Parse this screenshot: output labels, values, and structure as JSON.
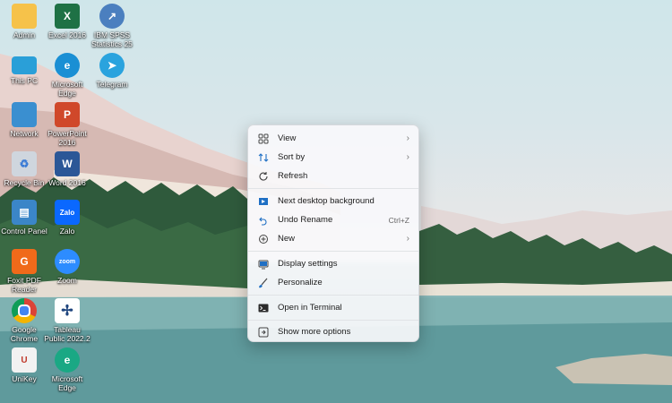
{
  "desktop": {
    "icons": [
      {
        "label": "Admin",
        "icon": "folder-icon",
        "color": "#f6c24a"
      },
      {
        "label": "Excel 2016",
        "icon": "excel-icon",
        "color": "#1e7145"
      },
      {
        "label": "IBM SPSS Statistics 25",
        "icon": "spss-icon",
        "color": "#4b7fbf"
      },
      {
        "label": "This PC",
        "icon": "computer-icon",
        "color": "#2a9fd8"
      },
      {
        "label": "Microsoft Edge",
        "icon": "edge-icon",
        "color": "#1a8fd4"
      },
      {
        "label": "Telegram",
        "icon": "telegram-icon",
        "color": "#2aa3de"
      },
      {
        "label": "Network",
        "icon": "network-icon",
        "color": "#3a8fd0"
      },
      {
        "label": "PowerPoint 2016",
        "icon": "powerpoint-icon",
        "color": "#d0482a"
      },
      {
        "label": "Recycle Bin",
        "icon": "recycle-bin-icon",
        "color": "#cfd6de"
      },
      {
        "label": "Word 2016",
        "icon": "word-icon",
        "color": "#2b5797"
      },
      {
        "label": "Control Panel",
        "icon": "control-panel-icon",
        "color": "#3b86c8"
      },
      {
        "label": "Zalo",
        "icon": "zalo-icon",
        "color": "#0a68ff"
      },
      {
        "label": "Foxit PDF Reader",
        "icon": "foxit-icon",
        "color": "#f06a1a"
      },
      {
        "label": "Zoom",
        "icon": "zoom-icon",
        "color": "#2d8cff"
      },
      {
        "label": "Google Chrome",
        "icon": "chrome-icon",
        "color": "#db4437"
      },
      {
        "label": "Tableau Public 2022.2",
        "icon": "tableau-icon",
        "color": "#1f457e"
      },
      {
        "label": "UniKey",
        "icon": "unikey-icon",
        "color": "#f2f2f2"
      },
      {
        "label": "Microsoft Edge",
        "icon": "edge-icon",
        "color": "#1aa884"
      }
    ]
  },
  "context_menu": {
    "items": [
      {
        "label": "View",
        "icon": "view-grid-icon",
        "shortcut": "",
        "submenu": true
      },
      {
        "label": "Sort by",
        "icon": "sort-icon",
        "shortcut": "",
        "submenu": true
      },
      {
        "label": "Refresh",
        "icon": "refresh-icon",
        "shortcut": "",
        "submenu": false
      },
      {
        "label": "Next desktop background",
        "icon": "next-background-icon",
        "shortcut": "",
        "submenu": false
      },
      {
        "label": "Undo Rename",
        "icon": "undo-icon",
        "shortcut": "Ctrl+Z",
        "submenu": false
      },
      {
        "label": "New",
        "icon": "new-icon",
        "shortcut": "",
        "submenu": true
      },
      {
        "label": "Display settings",
        "icon": "display-icon",
        "shortcut": "",
        "submenu": false
      },
      {
        "label": "Personalize",
        "icon": "brush-icon",
        "shortcut": "",
        "submenu": false
      },
      {
        "label": "Open in Terminal",
        "icon": "terminal-icon",
        "shortcut": "",
        "submenu": false
      },
      {
        "label": "Show more options",
        "icon": "more-options-icon",
        "shortcut": "",
        "submenu": false
      }
    ]
  }
}
